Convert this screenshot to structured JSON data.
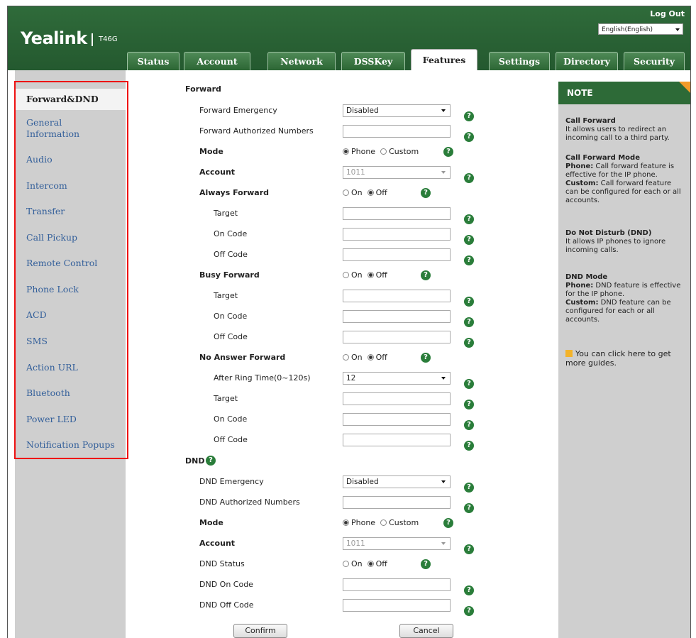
{
  "header": {
    "logo": "Yealink",
    "model": "T46G",
    "logout": "Log Out",
    "language": "English(English)"
  },
  "tabs": [
    "Status",
    "Account",
    "Network",
    "DSSKey",
    "Features",
    "Settings",
    "Directory",
    "Security"
  ],
  "active_tab": "Features",
  "sidebar": {
    "items": [
      "Forward&DND",
      "General Information",
      "Audio",
      "Intercom",
      "Transfer",
      "Call Pickup",
      "Remote Control",
      "Phone Lock",
      "ACD",
      "SMS",
      "Action URL",
      "Bluetooth",
      "Power LED",
      "Notification Popups"
    ],
    "active": "Forward&DND"
  },
  "form": {
    "forward_title": "Forward",
    "forward_emergency": {
      "label": "Forward Emergency",
      "value": "Disabled"
    },
    "forward_authorized": {
      "label": "Forward Authorized Numbers",
      "value": ""
    },
    "mode": {
      "label": "Mode",
      "opt1": "Phone",
      "opt2": "Custom"
    },
    "account": {
      "label": "Account",
      "value": "1011"
    },
    "always_forward": {
      "label": "Always Forward",
      "on": "On",
      "off": "Off"
    },
    "target": "Target",
    "on_code": "On Code",
    "off_code": "Off Code",
    "busy_forward": {
      "label": "Busy Forward",
      "on": "On",
      "off": "Off"
    },
    "no_answer_forward": {
      "label": "No Answer Forward",
      "on": "On",
      "off": "Off"
    },
    "after_ring_time": {
      "label": "After Ring Time(0~120s)",
      "value": "12"
    },
    "dnd_title": "DND",
    "dnd_emergency": {
      "label": "DND Emergency",
      "value": "Disabled"
    },
    "dnd_authorized": {
      "label": "DND Authorized Numbers",
      "value": ""
    },
    "dnd_mode": {
      "label": "Mode",
      "opt1": "Phone",
      "opt2": "Custom"
    },
    "dnd_account": {
      "label": "Account",
      "value": "1011"
    },
    "dnd_status": {
      "label": "DND Status",
      "on": "On",
      "off": "Off"
    },
    "dnd_on_code": "DND On Code",
    "dnd_off_code": "DND Off Code",
    "confirm": "Confirm",
    "cancel": "Cancel",
    "help": "?"
  },
  "note": {
    "title": "NOTE",
    "call_forward_title": "Call Forward",
    "call_forward_text": "It allows users to redirect an incoming call to a third party.",
    "cf_mode_title": "Call Forward Mode",
    "cf_mode_phone_label": "Phone:",
    "cf_mode_phone_text": "Call forward feature is effective for the IP phone.",
    "cf_mode_custom_label": "Custom:",
    "cf_mode_custom_text": "Call forward feature can be configured for each or all accounts.",
    "dnd_title": "Do Not Disturb (DND)",
    "dnd_text": "It allows IP phones to ignore incoming calls.",
    "dnd_mode_title": "DND Mode",
    "dnd_mode_phone_label": "Phone:",
    "dnd_mode_phone_text": "DND feature is effective for the IP phone.",
    "dnd_mode_custom_label": "Custom:",
    "dnd_mode_custom_text": "DND feature can be configured for each or all accounts.",
    "guide_text": "You can click here to get more guides."
  },
  "colors": {
    "header_green": "#2d6a37",
    "sidebar_gray": "#cfcfcf",
    "highlight_red": "#e11111",
    "help_green": "#2a7d3a",
    "link_blue": "#335f9a"
  }
}
